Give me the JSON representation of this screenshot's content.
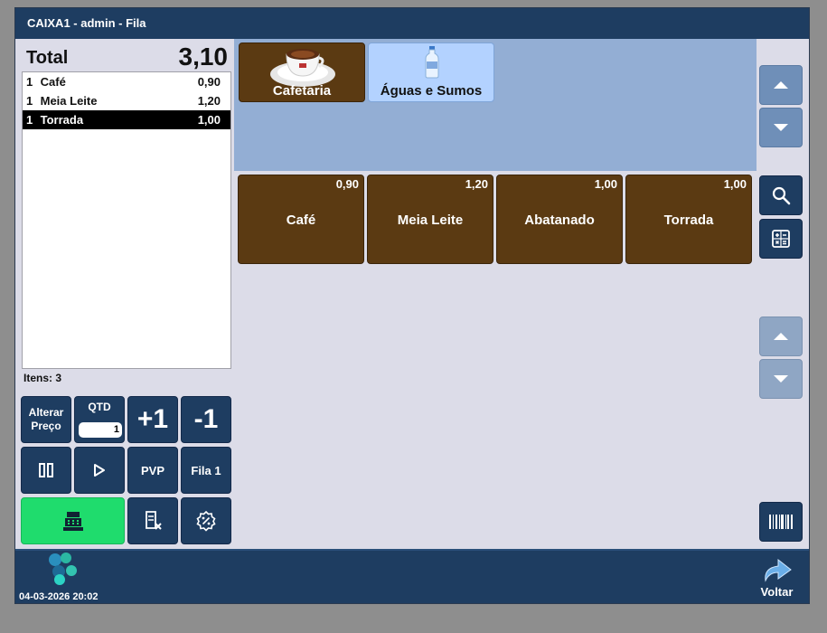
{
  "window": {
    "title": "CAIXA1 - admin - Fila"
  },
  "order": {
    "total_label": "Total",
    "total_value": "3,10",
    "items": [
      {
        "qty": "1",
        "name": "Café",
        "price": "0,90",
        "selected": false
      },
      {
        "qty": "1",
        "name": "Meia Leite",
        "price": "1,20",
        "selected": false
      },
      {
        "qty": "1",
        "name": "Torrada",
        "price": "1,00",
        "selected": true
      }
    ],
    "items_count": "Itens: 3"
  },
  "keypad": {
    "alterar_preco_line1": "Alterar",
    "alterar_preco_line2": "Preço",
    "qtd_label": "QTD",
    "qtd_value": "1",
    "plus_one": "+1",
    "minus_one": "-1",
    "pvp": "PVP",
    "fila": "Fila 1"
  },
  "categories": [
    {
      "label": "Cafetaria",
      "icon": "coffee-cup-icon"
    },
    {
      "label": "Águas e Sumos",
      "icon": "water-bottle-icon"
    }
  ],
  "products": [
    {
      "name": "Café",
      "price": "0,90"
    },
    {
      "name": "Meia Leite",
      "price": "1,20"
    },
    {
      "name": "Abatanado",
      "price": "1,00"
    },
    {
      "name": "Torrada",
      "price": "1,00"
    }
  ],
  "statusbar": {
    "datetime": "04-03-2026 20:02",
    "voltar_label": "Voltar"
  },
  "colors": {
    "titlebar": "#1e3d61",
    "category_area": "#93aed4",
    "product_button": "#5b3a12",
    "pay_button": "#1fdc6d",
    "selected_row": "#000000"
  }
}
